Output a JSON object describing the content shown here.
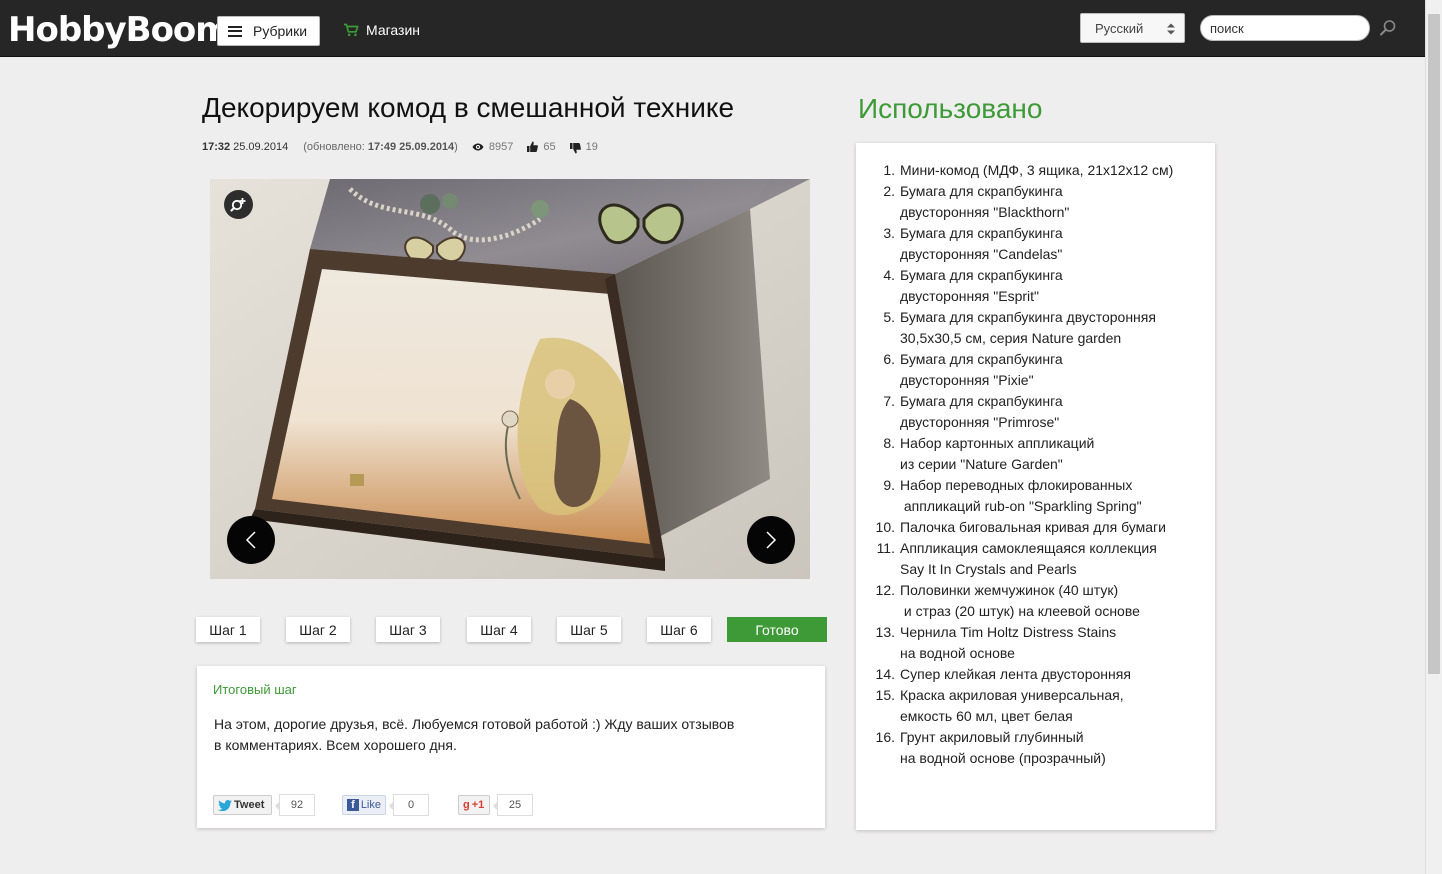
{
  "header": {
    "logo": "HobbyBoom",
    "rubrics_label": "Рубрики",
    "shop_label": "Магазин",
    "language": "Русский",
    "search_value": "поиск"
  },
  "article": {
    "title": "Декорируем комод в смешанной технике",
    "time": "17:32",
    "date": "25.09.2014",
    "updated_prefix": "(обновлено: ",
    "updated_value": "17:49 25.09.2014",
    "updated_suffix": ")",
    "views": "8957",
    "likes": "65",
    "dislikes": "19"
  },
  "steps": [
    "Шаг 1",
    "Шаг 2",
    "Шаг 3",
    "Шаг 4",
    "Шаг 5",
    "Шаг 6",
    "Готово"
  ],
  "active_step_color": "#3d9a37",
  "step_card": {
    "title": "Итоговый шаг",
    "text_line1": "На этом, дорогие друзья, всё. Любуемся готовой работой :) Жду ваших отзывов",
    "text_line2": "в комментариях. Всем хорошего дня."
  },
  "share": {
    "tweet_label": "Tweet",
    "tweet_count": "92",
    "like_label": "Like",
    "like_count": "0",
    "gplus_label": "+1",
    "gplus_count": "25"
  },
  "sidebar": {
    "title": "Использовано",
    "items": [
      {
        "num": "1.",
        "lines": [
          "Мини-комод (МДФ, 3 ящика, 21x12x12 см)"
        ]
      },
      {
        "num": "2.",
        "lines": [
          "Бумага для скрапбукинга",
          "двусторонняя \"Blackthorn\""
        ]
      },
      {
        "num": "3.",
        "lines": [
          "Бумага для скрапбукинга",
          "двусторонняя \"Candelas\""
        ]
      },
      {
        "num": "4.",
        "lines": [
          "Бумага для скрапбукинга",
          "двусторонняя \"Esprit\""
        ]
      },
      {
        "num": "5.",
        "lines": [
          "Бумага для скрапбукинга двусторонняя",
          "30,5x30,5 см, серия Nature garden"
        ]
      },
      {
        "num": "6.",
        "lines": [
          "Бумага для скрапбукинга",
          "двусторонняя \"Pixie\""
        ]
      },
      {
        "num": "7.",
        "lines": [
          "Бумага для скрапбукинга",
          "двусторонняя \"Primrose\""
        ]
      },
      {
        "num": "8.",
        "lines": [
          "Набор картонных аппликаций",
          "из серии \"Nature Garden\""
        ]
      },
      {
        "num": "9.",
        "lines": [
          "Набор переводных флокированных",
          " аппликаций rub-on \"Sparkling Spring\""
        ]
      },
      {
        "num": "10.",
        "lines": [
          "Палочка биговальная кривая для бумаги"
        ]
      },
      {
        "num": "11.",
        "lines": [
          "Аппликация самоклеящаяся коллекция",
          "Say It In Crystals and Pearls"
        ]
      },
      {
        "num": "12.",
        "lines": [
          "Половинки жемчужинок (40 штук)",
          " и страз (20 штук) на клеевой основе"
        ]
      },
      {
        "num": "13.",
        "lines": [
          "Чернила Tim Holtz Distress Stains",
          "на водной основе"
        ]
      },
      {
        "num": "14.",
        "lines": [
          "Супер клейкая лента двусторонняя"
        ]
      },
      {
        "num": "15.",
        "lines": [
          "Краска акриловая универсальная,",
          "емкость 60 мл, цвет белая"
        ]
      },
      {
        "num": "16.",
        "lines": [
          "Грунт акриловый глубинный",
          "на водной основе (прозрачный)"
        ]
      }
    ]
  },
  "icons": {
    "menu": "hamburger-icon",
    "cart": "cart-icon",
    "search": "search-icon",
    "views": "eye-icon",
    "like": "thumbs-up-icon",
    "dislike": "thumbs-down-icon",
    "zoom": "zoom-in-icon",
    "prev": "chevron-left-icon",
    "next": "chevron-right-icon"
  }
}
